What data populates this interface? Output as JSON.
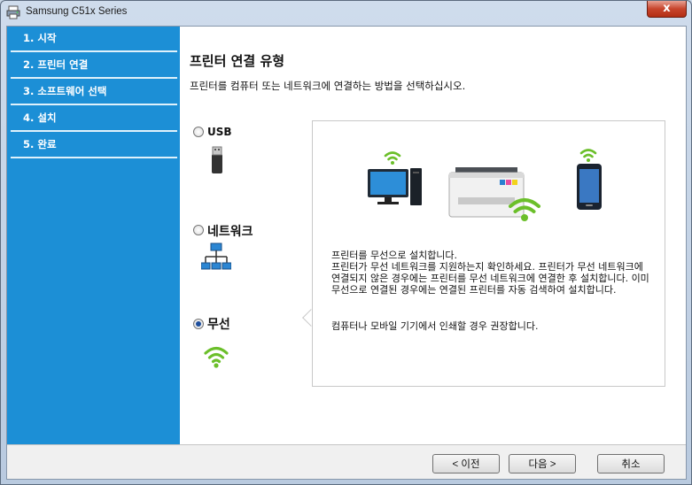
{
  "window": {
    "title": "Samsung C51x Series",
    "close_label": "x"
  },
  "sidebar": {
    "items": [
      {
        "label": "1. 시작"
      },
      {
        "label": "2. 프린터 연결"
      },
      {
        "label": "3. 소프트웨어 선택"
      },
      {
        "label": "4. 설치"
      },
      {
        "label": "5. 완료"
      }
    ]
  },
  "main": {
    "title": "프린터 연결 유형",
    "subtitle": "프린터를 컴퓨터 또는 네트워크에 연결하는 방법을 선택하십시오.",
    "options": [
      {
        "label": "USB",
        "selected": false,
        "icon": "usb-icon"
      },
      {
        "label": "네트워크",
        "selected": false,
        "icon": "network-icon"
      },
      {
        "label": "무선",
        "selected": true,
        "icon": "wifi-icon"
      }
    ],
    "description": {
      "line1": "프린터를 무선으로 설치합니다.",
      "paragraph": "프린터가 무선 네트워크를 지원하는지 확인하세요.  프린터가 무선 네트워크에 연결되지 않은 경우에는 프린터를 무선 네트워크에 연결한 후 설치합니다. 이미 무선으로 연결된 경우에는 연결된 프린터를 자동 검색하여 설치합니다.",
      "recommendation": "컴퓨터나 모바일 기기에서 인쇄할 경우 권장합니다."
    }
  },
  "footer": {
    "back_label": "< 이전",
    "next_label": "다음 >",
    "cancel_label": "취소"
  },
  "colors": {
    "sidebar": "#1c8fd6",
    "wifi": "#6bbf2a",
    "close_button": "#c7452c"
  }
}
